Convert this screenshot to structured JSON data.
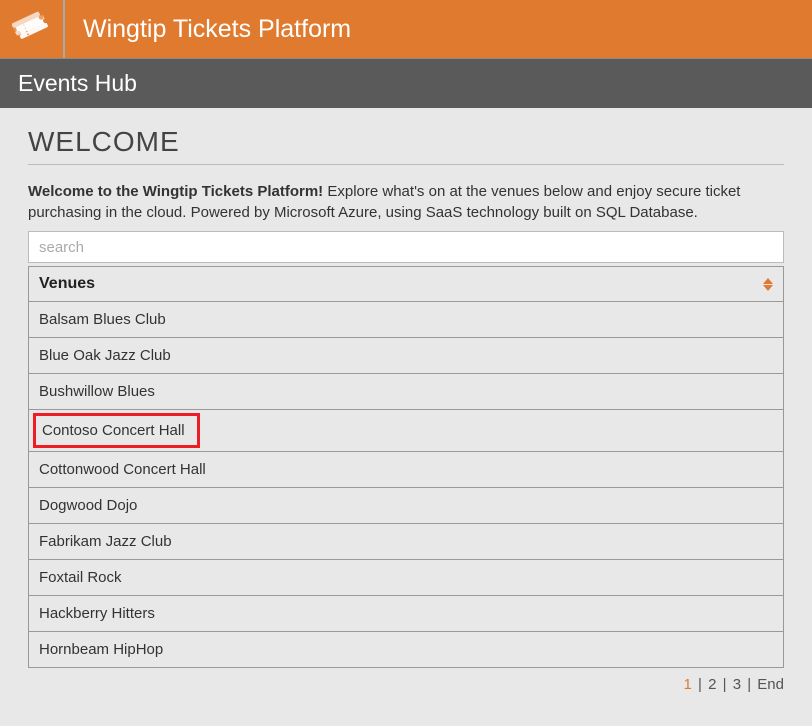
{
  "header": {
    "icon": "tickets-icon",
    "title": "Wingtip Tickets Platform",
    "subtitle": "Events Hub"
  },
  "main": {
    "welcome_heading": "WELCOME",
    "intro_bold": "Welcome to the Wingtip Tickets Platform!",
    "intro_rest": " Explore what's on at the venues below and enjoy secure ticket purchasing in the cloud. Powered by Microsoft Azure, using SaaS technology built on SQL Database.",
    "search_placeholder": "search",
    "column_header": "Venues",
    "venues": [
      {
        "name": "Balsam Blues Club",
        "highlighted": false
      },
      {
        "name": "Blue Oak Jazz Club",
        "highlighted": false
      },
      {
        "name": "Bushwillow Blues",
        "highlighted": false
      },
      {
        "name": "Contoso Concert Hall",
        "highlighted": true
      },
      {
        "name": "Cottonwood Concert Hall",
        "highlighted": false
      },
      {
        "name": "Dogwood Dojo",
        "highlighted": false
      },
      {
        "name": "Fabrikam Jazz Club",
        "highlighted": false
      },
      {
        "name": "Foxtail Rock",
        "highlighted": false
      },
      {
        "name": "Hackberry Hitters",
        "highlighted": false
      },
      {
        "name": "Hornbeam HipHop",
        "highlighted": false
      }
    ],
    "pagination": {
      "current": "1",
      "pages": [
        "2",
        "3"
      ],
      "end": "End",
      "separator": "|"
    }
  }
}
